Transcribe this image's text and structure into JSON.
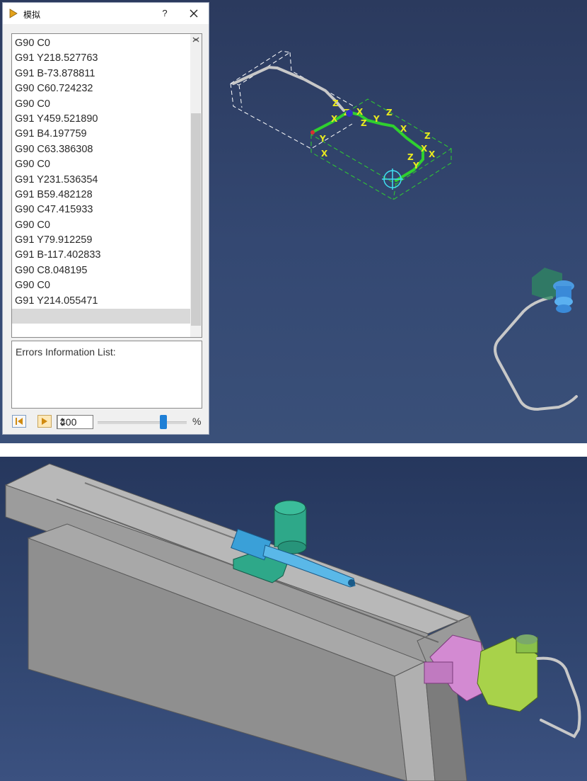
{
  "dialog": {
    "title": "模拟",
    "help_label": "?",
    "code_lines": [
      "G90 C0",
      "G91 Y218.527763",
      "G91 B-73.878811",
      "G90 C60.724232",
      "G90 C0",
      "G91 Y459.521890",
      "G91 B4.197759",
      "G90 C63.386308",
      "G90 C0",
      "G91 Y231.536354",
      "G91 B59.482128",
      "G90 C47.415933",
      "G90 C0",
      "G91 Y79.912259",
      "G91 B-117.402833",
      "G90 C8.048195",
      "G90 C0",
      "G91 Y214.055471",
      ""
    ],
    "selected_line": 18,
    "errors_label": "Errors Information List:",
    "speed_value": "400",
    "speed_unit": "%",
    "speed_slider_fraction": 0.74
  },
  "icons": {
    "title": "play-triangle-icon",
    "close": "close-x-icon",
    "rewind": "skip-to-start-icon",
    "play": "play-icon"
  },
  "colors": {
    "viewport_bg": "#344872",
    "path_green": "#2fd02f",
    "axis_yellow": "#e8e820",
    "tube_gray": "#c8c8c8",
    "slider_blue": "#1e7fd6",
    "machine_gray": "#a9a9a9",
    "carriage_teal": "#2ea889",
    "motor_blue": "#3aa0d8",
    "bend_pink": "#d38ad2",
    "clamp_lime": "#a8d24a"
  },
  "axis_labels": {
    "z": "Z",
    "y": "Y",
    "x": "X"
  }
}
